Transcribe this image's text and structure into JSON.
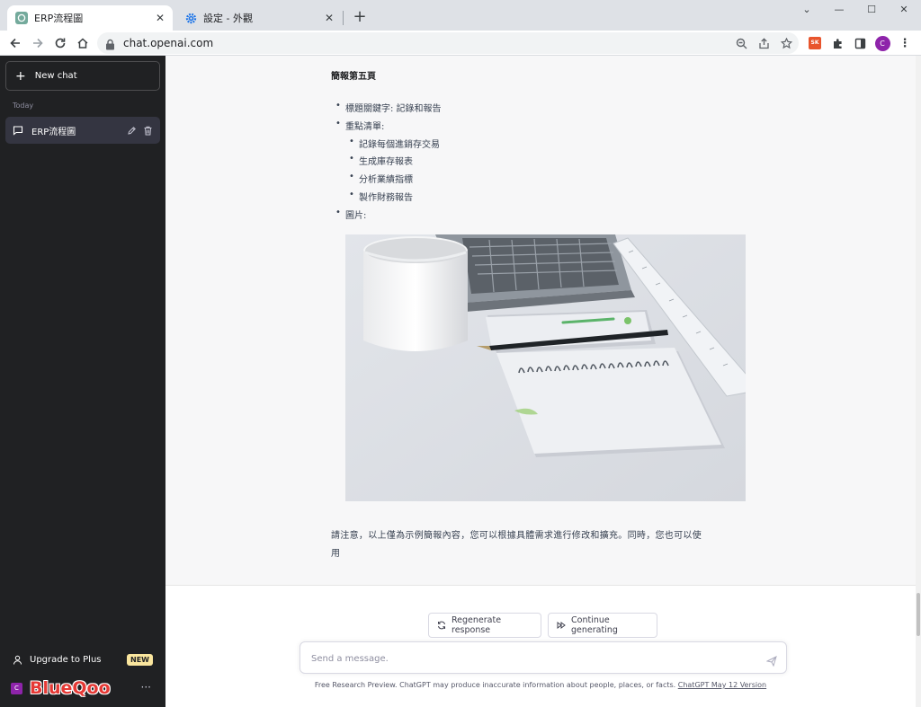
{
  "browser": {
    "tabs": [
      {
        "title": "ERP流程圖",
        "active": true,
        "favicon": "chatgpt-icon"
      },
      {
        "title": "設定 - 外觀",
        "active": false,
        "favicon": "gear-icon"
      }
    ],
    "new_tab": "+",
    "url": "chat.openai.com",
    "profile_initial": "C",
    "extension_label": "SK"
  },
  "sidebar": {
    "new_chat_label": "New chat",
    "section_today": "Today",
    "chats": [
      {
        "label": "ERP流程圖"
      }
    ],
    "upgrade_label": "Upgrade to Plus",
    "upgrade_badge": "NEW",
    "user_initial": "C",
    "watermark": "BlueQoo",
    "more": "···"
  },
  "message": {
    "heading": "簡報第五頁",
    "bullets": [
      {
        "text": "標題關鍵字: 記錄和報告",
        "level": 1
      },
      {
        "text": "重點清單:",
        "level": 1
      },
      {
        "text": "記錄每個進銷存交易",
        "level": 2
      },
      {
        "text": "生成庫存報表",
        "level": 2
      },
      {
        "text": "分析業績指標",
        "level": 2
      },
      {
        "text": "製作財務報告",
        "level": 2
      },
      {
        "text": "圖片:",
        "level": 1
      }
    ],
    "bullet_char": "•",
    "note_line1": "請注意，以上僅為示例簡報內容，您可以根據具體需求進行修改和擴充。同時，您也可以使",
    "note_line2": "用"
  },
  "actions": {
    "regenerate": "Regenerate response",
    "continue": "Continue generating"
  },
  "composer": {
    "placeholder": "Send a message."
  },
  "footer": {
    "text": "Free Research Preview. ChatGPT may produce inaccurate information about people, places, or facts.",
    "link": "ChatGPT May 12 Version"
  },
  "colors": {
    "sidebar_bg": "#202123",
    "active_chat_bg": "#343541",
    "message_bg": "#f7f7f8",
    "badge_bg": "#fae69e",
    "profile_bg": "#8e24aa"
  }
}
